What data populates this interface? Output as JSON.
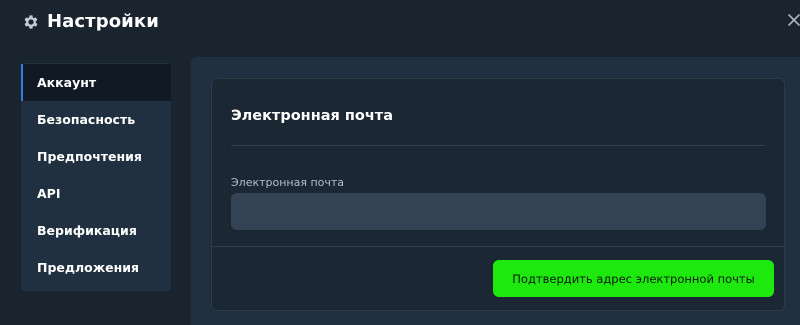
{
  "header": {
    "title": "Настройки",
    "icon": "gear-icon",
    "close_icon": "close-icon"
  },
  "sidebar": {
    "items": [
      {
        "label": "Аккаунт",
        "active": true
      },
      {
        "label": "Безопасность",
        "active": false
      },
      {
        "label": "Предпочтения",
        "active": false
      },
      {
        "label": "API",
        "active": false
      },
      {
        "label": "Верификация",
        "active": false
      },
      {
        "label": "Предложения",
        "active": false
      }
    ]
  },
  "card": {
    "title": "Электронная почта",
    "email_label": "Электронная почта",
    "email_value": "",
    "confirm_label": "Подтвердить адрес электронной почты"
  },
  "colors": {
    "background": "#1a242f",
    "panel": "#213040",
    "active_indicator": "#2f7de1",
    "accent_button": "#1ee90f"
  }
}
